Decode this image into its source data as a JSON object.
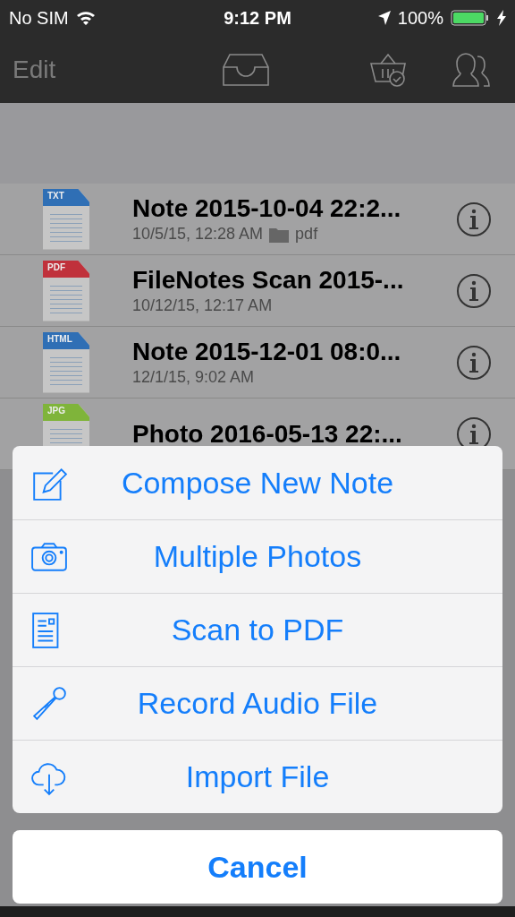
{
  "status_bar": {
    "carrier": "No SIM",
    "time": "9:12 PM",
    "battery": "100%"
  },
  "nav_bar": {
    "edit": "Edit"
  },
  "files": [
    {
      "type": "TXT",
      "kind": "txt",
      "title": "Note 2015-10-04 22:2...",
      "date": "10/5/15, 12:28 AM",
      "folder": "pdf"
    },
    {
      "type": "PDF",
      "kind": "pdf",
      "title": "FileNotes Scan 2015-...",
      "date": "10/12/15, 12:17 AM"
    },
    {
      "type": "HTML",
      "kind": "html",
      "title": "Note 2015-12-01 08:0...",
      "date": "12/1/15, 9:02 AM"
    },
    {
      "type": "JPG",
      "kind": "jpg",
      "title": "Photo 2016-05-13 22:..."
    }
  ],
  "action_sheet": {
    "items": [
      {
        "kind": "compose",
        "label": "Compose New Note"
      },
      {
        "kind": "camera",
        "label": "Multiple Photos"
      },
      {
        "kind": "scan",
        "label": "Scan to PDF"
      },
      {
        "kind": "mic",
        "label": "Record Audio File"
      },
      {
        "kind": "import",
        "label": "Import File"
      }
    ],
    "cancel": "Cancel"
  }
}
